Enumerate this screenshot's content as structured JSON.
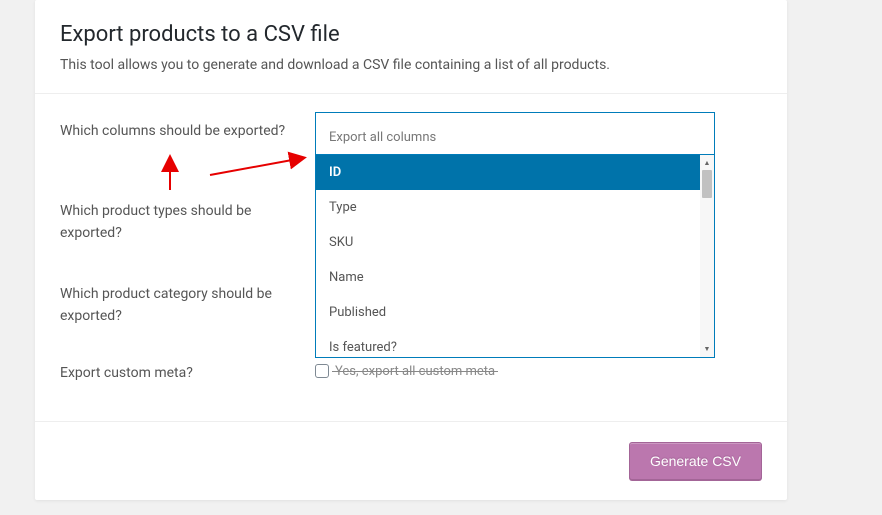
{
  "header": {
    "title": "Export products to a CSV file",
    "description": "This tool allows you to generate and download a CSV file containing a list of all products."
  },
  "form": {
    "columns": {
      "label": "Which columns should be exported?",
      "placeholder": "Export all columns"
    },
    "types": {
      "label": "Which product types should be exported?"
    },
    "category": {
      "label": "Which product category should be exported?"
    },
    "meta": {
      "label": "Export custom meta?",
      "checkbox_text": "Yes, export all custom meta"
    }
  },
  "dropdown": {
    "options": [
      "ID",
      "Type",
      "SKU",
      "Name",
      "Published",
      "Is featured?"
    ],
    "highlighted_index": 0
  },
  "footer": {
    "generate_btn": "Generate CSV"
  }
}
